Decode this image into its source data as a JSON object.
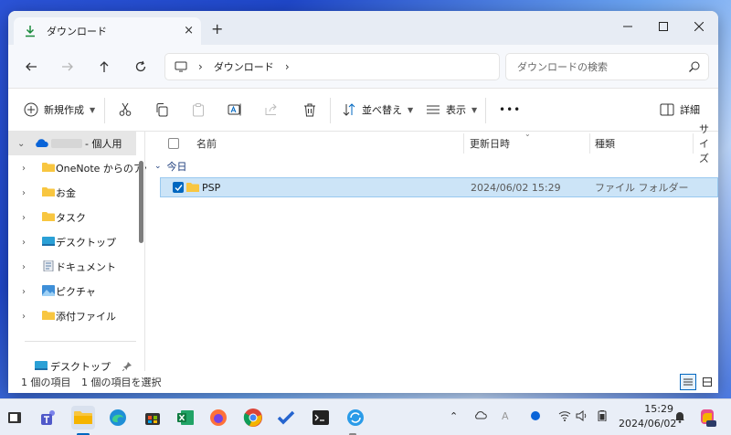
{
  "tab": {
    "title": "ダウンロード",
    "close": "×",
    "new_tab": "+"
  },
  "window_controls": {
    "minimize": "—",
    "maximize": "☐",
    "close": "✕"
  },
  "address": {
    "segments": [
      "ダウンロード"
    ]
  },
  "search": {
    "placeholder": "ダウンロードの検索"
  },
  "toolbar": {
    "new_label": "新規作成",
    "sort_label": "並べ替え",
    "view_label": "表示",
    "more_label": "•••",
    "details_label": "詳細"
  },
  "sidebar": {
    "account_label": "- 個人用",
    "items": [
      {
        "label": "OneNote からのアップ",
        "icon": "folder-icon"
      },
      {
        "label": "お金",
        "icon": "folder-icon"
      },
      {
        "label": "タスク",
        "icon": "folder-icon"
      },
      {
        "label": "デスクトップ",
        "icon": "desktop-folder-icon"
      },
      {
        "label": "ドキュメント",
        "icon": "documents-folder-icon"
      },
      {
        "label": "ピクチャ",
        "icon": "pictures-folder-icon"
      },
      {
        "label": "添付ファイル",
        "icon": "folder-icon"
      }
    ],
    "quick_access": [
      {
        "label": "デスクトップ",
        "icon": "desktop-folder-icon"
      }
    ]
  },
  "columns": {
    "name": "名前",
    "modified": "更新日時",
    "type": "種類",
    "size": "サイズ"
  },
  "groups": [
    {
      "label": "今日",
      "rows": [
        {
          "name": "PSP",
          "modified": "2024/06/02 15:29",
          "type": "ファイル フォルダー",
          "selected": true
        }
      ]
    }
  ],
  "status": {
    "count": "1 個の項目",
    "selected": "1 個の項目を選択"
  },
  "taskbar": {
    "time": "15:29",
    "date": "2024/06/02"
  },
  "colors": {
    "accent": "#0067c0",
    "selection_bg": "#cce4f7",
    "folder_yellow": "#f8c640",
    "taskbar_bg": "#e9eef7"
  }
}
